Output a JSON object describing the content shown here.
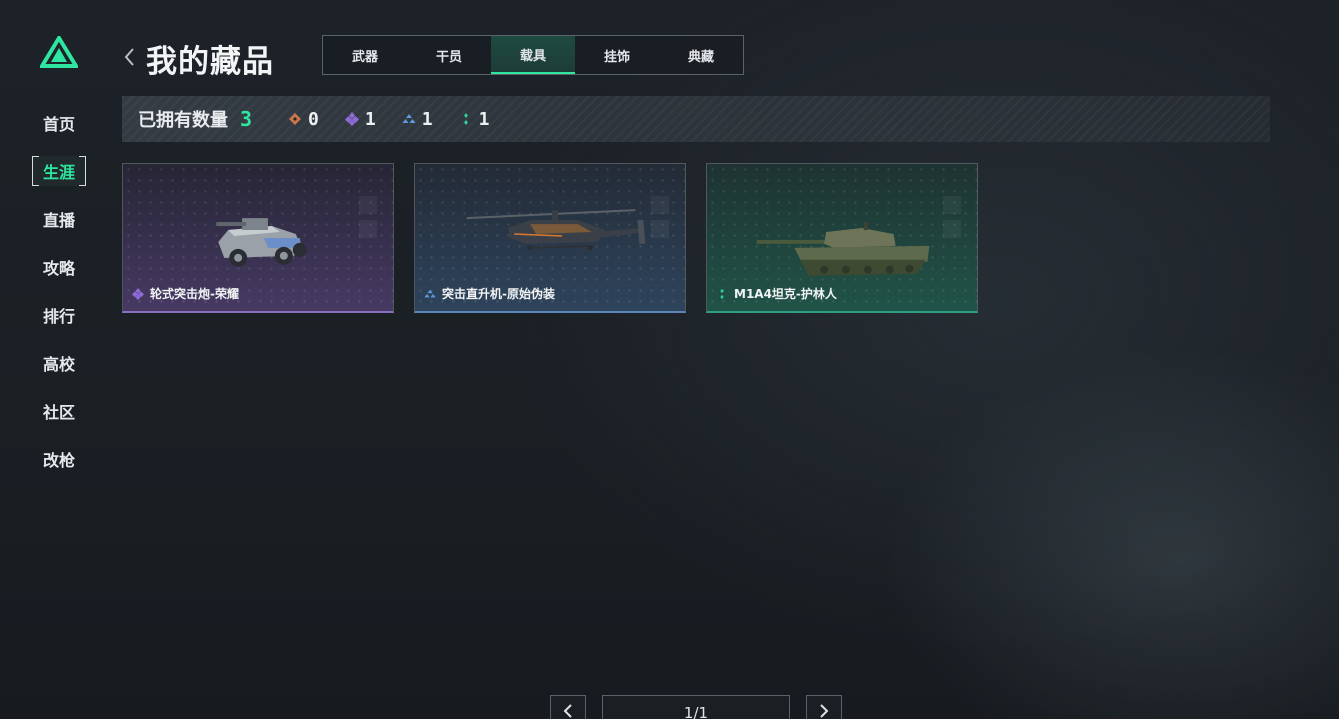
{
  "sidebar": {
    "items": [
      {
        "label": "首页"
      },
      {
        "label": "生涯"
      },
      {
        "label": "直播"
      },
      {
        "label": "攻略"
      },
      {
        "label": "排行"
      },
      {
        "label": "高校"
      },
      {
        "label": "社区"
      },
      {
        "label": "改枪"
      }
    ],
    "active_index": 1
  },
  "header": {
    "title": "我的藏品",
    "tabs": [
      {
        "label": "武器"
      },
      {
        "label": "干员"
      },
      {
        "label": "载具"
      },
      {
        "label": "挂饰"
      },
      {
        "label": "典藏"
      }
    ],
    "active_tab_index": 2
  },
  "summary": {
    "owned_label": "已拥有数量",
    "owned_count": "3",
    "rarity_counts": [
      {
        "icon": "diamond-orange-icon",
        "color": "#c9774a",
        "count": "0"
      },
      {
        "icon": "diamond-purple-icon",
        "color": "#8f6ad6",
        "count": "1"
      },
      {
        "icon": "triangle-blue-icon",
        "color": "#5f9be0",
        "count": "1"
      },
      {
        "icon": "dots-green-icon",
        "color": "#2fcf96",
        "count": "1"
      }
    ]
  },
  "vehicles": [
    {
      "name": "轮式突击炮-荣耀",
      "rarity_color": "#8f6ad6",
      "rarity_icon": "diamond-purple-icon"
    },
    {
      "name": "突击直升机-原始伪装",
      "rarity_color": "#5f9be0",
      "rarity_icon": "triangle-blue-icon"
    },
    {
      "name": "M1A4坦克-护林人",
      "rarity_color": "#2fcf96",
      "rarity_icon": "dots-green-icon"
    }
  ],
  "pagination": {
    "text": "1/1"
  },
  "colors": {
    "accent": "#2fe6a0",
    "background": "#1c2126"
  }
}
